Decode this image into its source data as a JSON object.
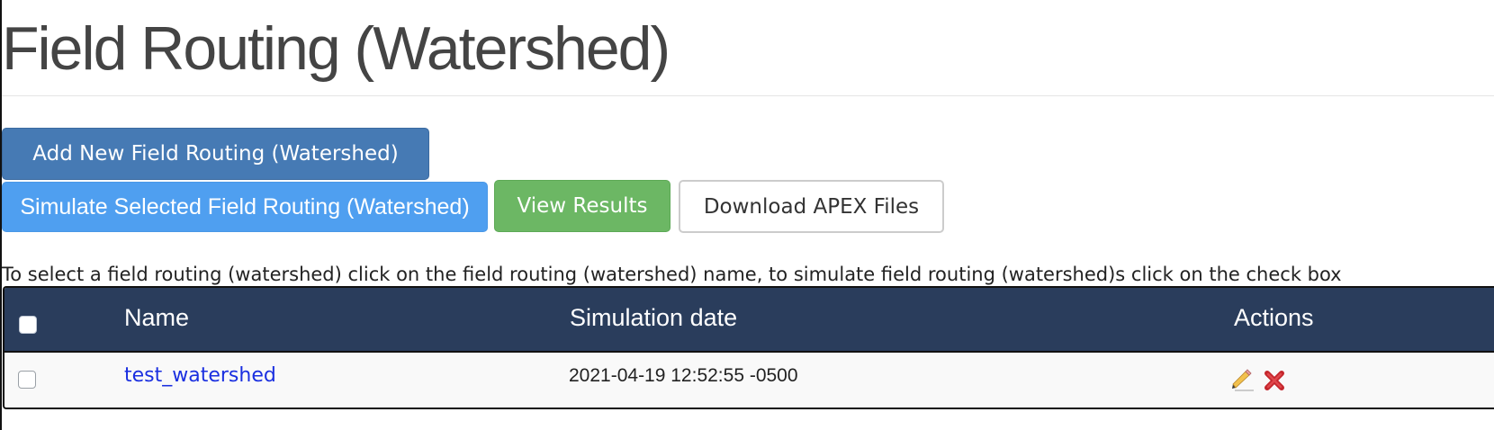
{
  "page": {
    "title": "Field Routing (Watershed)"
  },
  "toolbar": {
    "add_label": "Add New Field Routing (Watershed)",
    "simulate_label": "Simulate Selected Field Routing (Watershed)",
    "results_label": "View Results",
    "download_label": "Download APEX Files"
  },
  "instructions": "To select a field routing (watershed) click on the field routing (watershed) name, to simulate field routing (watershed)s click on the check box",
  "table": {
    "headers": {
      "name": "Name",
      "date": "Simulation date",
      "actions": "Actions"
    },
    "rows": [
      {
        "name": "test_watershed",
        "date": "2021-04-19 12:52:55 -0500",
        "checked": false,
        "actions": [
          "edit-pencil-icon",
          "delete-x-icon"
        ]
      }
    ]
  },
  "colors": {
    "add_button": "#467ab4",
    "simulate_button": "#4f9ff0",
    "results_button": "#6cb764",
    "table_header": "#2a3d5c",
    "link": "#1a2fe0",
    "delete": "#c4262c"
  }
}
